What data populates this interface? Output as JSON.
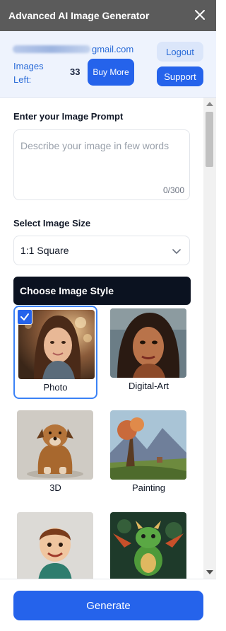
{
  "window": {
    "title": "Advanced AI Image Generator"
  },
  "account": {
    "email_visible": "gmail.com",
    "images_left_label": "Images Left:",
    "images_left_count": "33",
    "buy_more_label": "Buy More",
    "logout_label": "Logout",
    "support_label": "Support"
  },
  "prompt": {
    "label": "Enter your Image Prompt",
    "placeholder": "Describe your image in few words",
    "char_count": "0/300"
  },
  "size": {
    "label": "Select Image Size",
    "selected": "1:1 Square"
  },
  "styles": {
    "header": "Choose Image Style",
    "items": [
      {
        "label": "Photo",
        "selected": true
      },
      {
        "label": "Digital-Art",
        "selected": false
      },
      {
        "label": "3D",
        "selected": false
      },
      {
        "label": "Painting",
        "selected": false
      },
      {
        "label": "",
        "selected": false
      },
      {
        "label": "",
        "selected": false
      }
    ]
  },
  "footer": {
    "generate_label": "Generate"
  },
  "colors": {
    "accent": "#2563eb",
    "titlebar": "#5b5b5b",
    "account_bg": "#eef3fd",
    "style_header_bg": "#0b1220"
  }
}
